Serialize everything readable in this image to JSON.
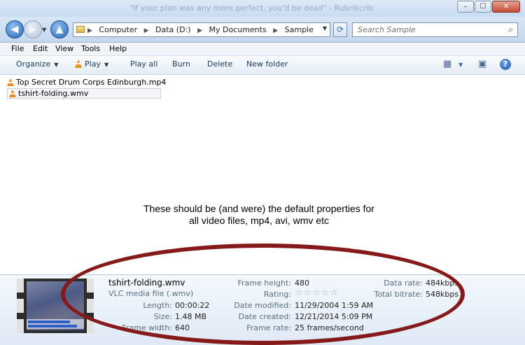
{
  "window": {
    "title": "\"If your plan was any more perfect, you'd be dead\" - Rubrikcrib",
    "controls": [
      "–",
      "☐",
      "✕"
    ]
  },
  "address": {
    "crumbs": [
      "Computer",
      "Data (D:)",
      "My Documents",
      "Sample"
    ],
    "separator": "▶",
    "search_placeholder": "Search Sample"
  },
  "menu": {
    "items": [
      "File",
      "Edit",
      "View",
      "Tools",
      "Help"
    ]
  },
  "toolbar": {
    "organize": "Organize",
    "play": "Play",
    "play_all": "Play all",
    "burn": "Burn",
    "delete": "Delete",
    "new_folder": "New folder",
    "view_icon": "view-options-icon",
    "preview_icon": "preview-pane-icon",
    "help_icon": "help-icon"
  },
  "files": [
    {
      "name": "Top Secret Drum Corps Edinburgh.mp4",
      "icon": "vlc-cone-icon",
      "selected": false
    },
    {
      "name": "tshirt-folding.wmv",
      "icon": "vlc-cone-icon",
      "selected": true
    }
  ],
  "annotation": {
    "line1": "These should be (and were) the default properties for",
    "line2": "all video files, mp4, avi, wmv etc"
  },
  "details": {
    "filename": "tshirt-folding.wmv",
    "filetype": "VLC media file (.wmv)",
    "length_label": "Length:",
    "length": "00:00:22",
    "size_label": "Size:",
    "size": "1.48 MB",
    "frame_width_label": "Frame width:",
    "frame_width": "640",
    "frame_height_label": "Frame height:",
    "frame_height": "480",
    "rating_label": "Rating:",
    "rating_stars": 0,
    "rating_max": 5,
    "date_modified_label": "Date modified:",
    "date_modified": "11/29/2004 1:59 AM",
    "date_created_label": "Date created:",
    "date_created": "12/21/2014 5:09 PM",
    "frame_rate_label": "Frame rate:",
    "frame_rate": "25 frames/second",
    "data_rate_label": "Data rate:",
    "data_rate": "484kbps",
    "total_bitrate_label": "Total bitrate:",
    "total_bitrate": "548kbps"
  },
  "colors": {
    "highlight_ellipse": "#851a1a",
    "vlc_orange": "#f08a1c"
  }
}
